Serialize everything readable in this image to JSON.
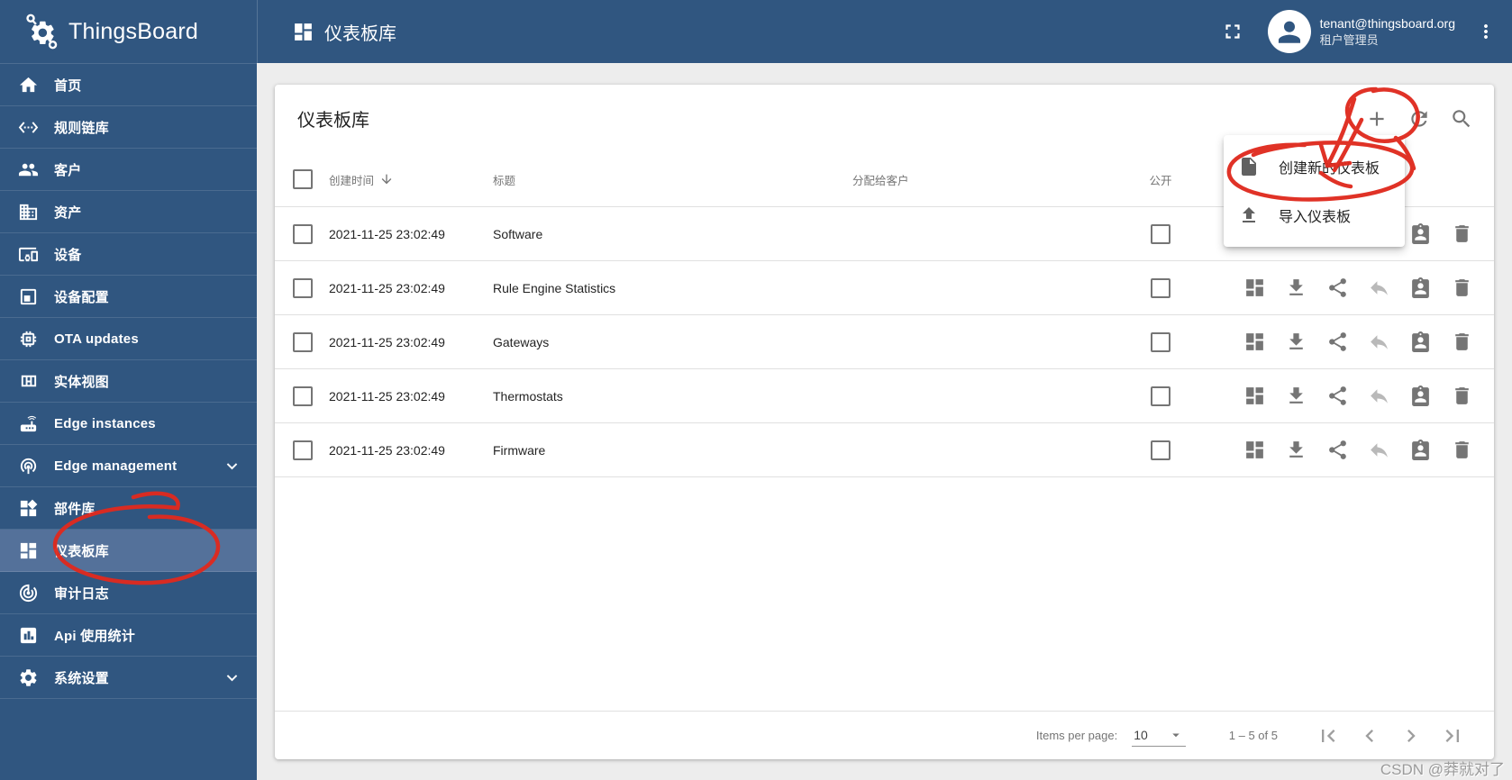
{
  "app": {
    "name": "ThingsBoard"
  },
  "topbar": {
    "title": "仪表板库",
    "user_email": "tenant@thingsboard.org",
    "user_role": "租户管理员",
    "icons": [
      "fullscreen-icon",
      "avatar",
      "kebab-menu-icon"
    ]
  },
  "sidebar": {
    "items": [
      {
        "label": "首页",
        "icon": "home-icon"
      },
      {
        "label": "规则链库",
        "icon": "rule-chains-icon"
      },
      {
        "label": "客户",
        "icon": "customers-icon"
      },
      {
        "label": "资产",
        "icon": "assets-icon"
      },
      {
        "label": "设备",
        "icon": "devices-icon"
      },
      {
        "label": "设备配置",
        "icon": "device-profiles-icon"
      },
      {
        "label": "OTA updates",
        "icon": "ota-updates-icon"
      },
      {
        "label": "实体视图",
        "icon": "entity-views-icon"
      },
      {
        "label": "Edge instances",
        "icon": "edge-instances-icon"
      },
      {
        "label": "Edge management",
        "icon": "edge-management-icon",
        "expandable": true
      },
      {
        "label": "部件库",
        "icon": "widgets-library-icon"
      },
      {
        "label": "仪表板库",
        "icon": "dashboards-icon",
        "selected": true
      },
      {
        "label": "审计日志",
        "icon": "audit-logs-icon"
      },
      {
        "label": "Api 使用统计",
        "icon": "api-usage-icon"
      },
      {
        "label": "系统设置",
        "icon": "settings-icon",
        "expandable": true
      }
    ]
  },
  "page": {
    "card_title": "仪表板库",
    "toolbar_icons": [
      "add-icon",
      "refresh-icon",
      "search-icon"
    ],
    "table": {
      "headers": {
        "created_time": "创建时间",
        "title": "标题",
        "assigned_to_customer": "分配给客户",
        "public": "公开"
      },
      "sort": {
        "column": "创建时间",
        "direction": "desc"
      },
      "row_action_icons": [
        "open-dashboard",
        "export-dashboard",
        "make-public",
        "make-private",
        "manage-assigned-customers",
        "delete-dashboard"
      ],
      "rows": [
        {
          "created_time": "2021-11-25 23:02:49",
          "title": "Software",
          "assigned_to_customer": "",
          "public": false
        },
        {
          "created_time": "2021-11-25 23:02:49",
          "title": "Rule Engine Statistics",
          "assigned_to_customer": "",
          "public": false
        },
        {
          "created_time": "2021-11-25 23:02:49",
          "title": "Gateways",
          "assigned_to_customer": "",
          "public": false
        },
        {
          "created_time": "2021-11-25 23:02:49",
          "title": "Thermostats",
          "assigned_to_customer": "",
          "public": false
        },
        {
          "created_time": "2021-11-25 23:02:49",
          "title": "Firmware",
          "assigned_to_customer": "",
          "public": false
        }
      ]
    },
    "menu": {
      "items": [
        {
          "label": "创建新的仪表板",
          "icon": "create-dashboard-file-icon"
        },
        {
          "label": "导入仪表板",
          "icon": "import-dashboard-upload-icon"
        }
      ]
    },
    "pagination": {
      "items_per_page_label": "Items per page:",
      "items_per_page_value": "10",
      "range_label": "1 – 5 of 5",
      "nav_icons": [
        "first-page-icon",
        "prev-page-icon",
        "next-page-icon",
        "last-page-icon"
      ]
    }
  },
  "annotations": {
    "color": "#df2a1e",
    "shapes": [
      "circle-around-dashboards-sidebar-item",
      "circle-around-add-button",
      "arrow-to-create-menu-item",
      "circle-around-create-menu-item"
    ]
  },
  "watermark": "CSDN @莽就对了",
  "colors": {
    "primary": "#305680",
    "sidebar_selected": "#54719a",
    "content_background": "#ededed",
    "icon_gray": "#757575",
    "annotation_red": "#df2a1e"
  }
}
